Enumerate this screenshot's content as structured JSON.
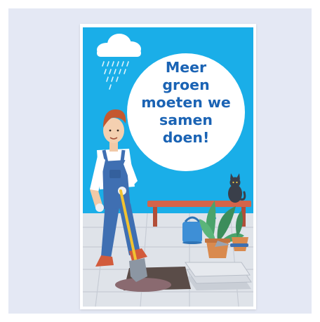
{
  "poster": {
    "headline": "Meer\ngroen\nmoeten we\nsamen\ndoen!"
  },
  "colors": {
    "page_background": "#e4e8f4",
    "sky": "#1aaee8",
    "headline_text": "#1a63b4",
    "bubble": "#ffffff",
    "overalls": "#3f6fb2",
    "bench": "#d4644a",
    "watering_can": "#3e8fd6",
    "plant": "#4aa36b",
    "pavement": "#dfe3e9"
  },
  "icons": [
    "rain-cloud-icon",
    "cat-icon",
    "watering-can-icon",
    "potted-plant-icon",
    "shovel-icon",
    "trowel-icon"
  ]
}
